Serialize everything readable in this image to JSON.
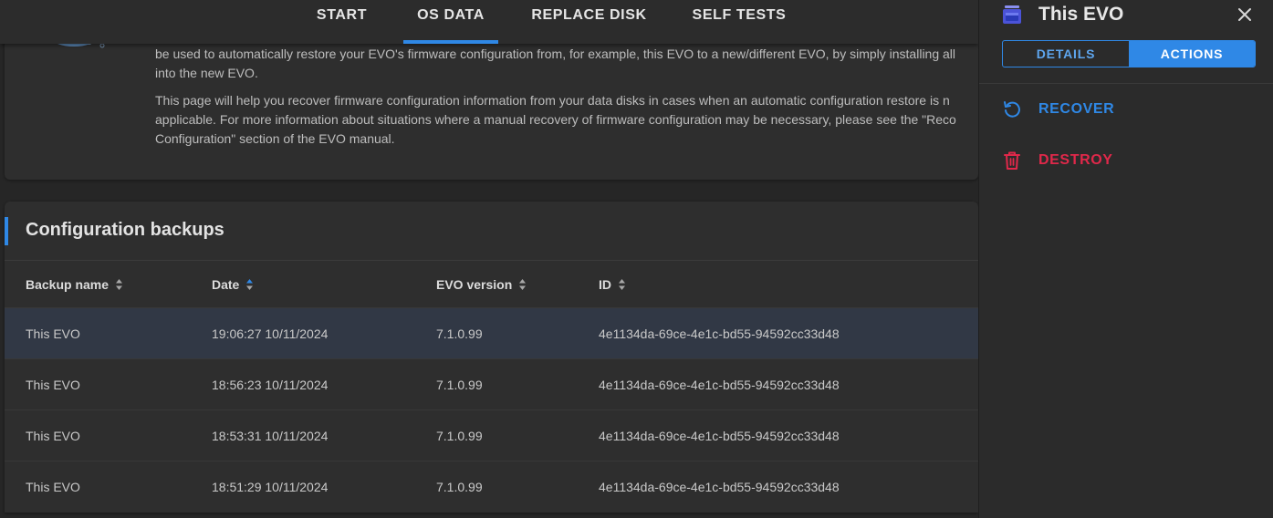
{
  "colors": {
    "accent": "#2f88e6",
    "danger": "#e0284a",
    "selected_row": "#313845"
  },
  "topnav": {
    "tabs": [
      {
        "label": "START",
        "active": false
      },
      {
        "label": "OS DATA",
        "active": true
      },
      {
        "label": "REPLACE DISK",
        "active": false
      },
      {
        "label": "SELF TESTS",
        "active": false
      }
    ]
  },
  "intro": {
    "paragraph1_line1": "be used to automatically restore your EVO's firmware configuration from, for example, this EVO to a new/different EVO, by simply installing all",
    "paragraph1_line2": "into the new EVO.",
    "paragraph2_line1": "This page will help you recover firmware configuration information from your data disks in cases when an automatic configuration restore is n",
    "paragraph2_line2": "applicable. For more information about situations where a manual recovery of firmware configuration may be necessary, please see the \"Reco",
    "paragraph2_line3": "Configuration\" section of the EVO manual."
  },
  "backups": {
    "title": "Configuration backups",
    "columns": [
      {
        "label": "Backup name",
        "icon": "sort-icon"
      },
      {
        "label": "Date",
        "icon": "sort-icon"
      },
      {
        "label": "EVO version",
        "icon": "sort-icon"
      },
      {
        "label": "ID",
        "icon": "sort-icon"
      }
    ],
    "rows": [
      {
        "name": "This EVO",
        "date": "19:06:27 10/11/2024",
        "version": "7.1.0.99",
        "id": "4e1134da-69ce-4e1c-bd55-94592cc33d48",
        "selected": true
      },
      {
        "name": "This EVO",
        "date": "18:56:23 10/11/2024",
        "version": "7.1.0.99",
        "id": "4e1134da-69ce-4e1c-bd55-94592cc33d48",
        "selected": false
      },
      {
        "name": "This EVO",
        "date": "18:53:31 10/11/2024",
        "version": "7.1.0.99",
        "id": "4e1134da-69ce-4e1c-bd55-94592cc33d48",
        "selected": false
      },
      {
        "name": "This EVO",
        "date": "18:51:29 10/11/2024",
        "version": "7.1.0.99",
        "id": "4e1134da-69ce-4e1c-bd55-94592cc33d48",
        "selected": false
      }
    ]
  },
  "panel": {
    "title": "This EVO",
    "icon": "backup-icon",
    "segments": {
      "details": "DETAILS",
      "actions": "ACTIONS",
      "active": "actions"
    },
    "actions": [
      {
        "label": "RECOVER",
        "icon": "recover-icon"
      },
      {
        "label": "DESTROY",
        "icon": "trash-icon"
      }
    ]
  }
}
